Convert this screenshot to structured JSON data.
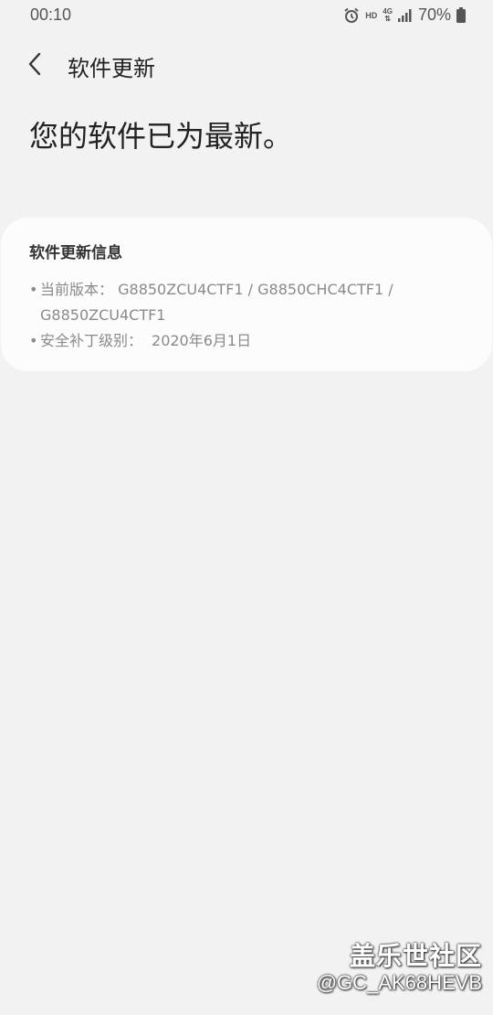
{
  "status_bar": {
    "time": "00:10",
    "network_hd": "HD",
    "network_4g": "4G",
    "battery": "70%"
  },
  "header": {
    "title": "软件更新"
  },
  "main": {
    "headline": "您的软件已为最新。"
  },
  "card": {
    "title": "软件更新信息",
    "current_version_label": "当前版本：",
    "current_version_line1": "G8850ZCU4CTF1 / G8850CHC4CTF1 /",
    "current_version_line2": "G8850ZCU4CTF1",
    "patch_label": "安全补丁级别：",
    "patch_value": "2020年6月1日"
  },
  "watermark": {
    "brand": "盖乐世社区",
    "user": "@GC_AK68HEVB"
  },
  "colors": {
    "background": "#f2f2f2",
    "card": "#fcfcfc",
    "secondary_text": "#8a8a8a"
  },
  "icons": [
    "alarm-icon",
    "signal-icon",
    "battery-icon",
    "back-arrow-icon"
  ]
}
